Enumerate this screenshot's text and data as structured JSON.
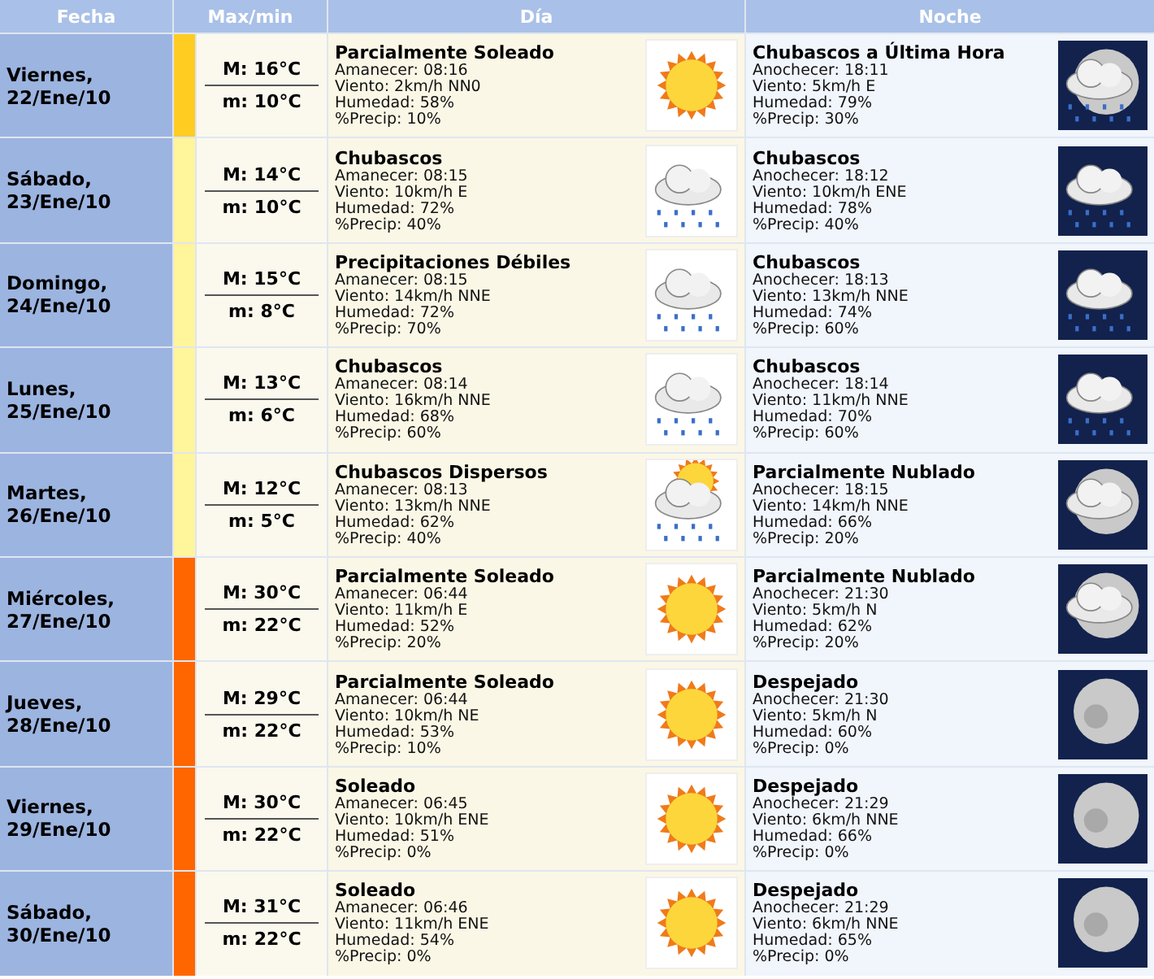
{
  "headers": [
    "Fecha",
    "Max/min",
    "Día",
    "Noche"
  ],
  "rows": [
    {
      "date": "Viernes,",
      "date2": "22/Ene/10",
      "color": "#ffcc22",
      "max": "M: 16°C",
      "min": "m: 10°C",
      "day": {
        "title": "Parcialmente Soleado",
        "lines": [
          "Amanecer: 08:16",
          "Viento: 2km/h NN0",
          "Humedad: 58%",
          "%Precip: 10%"
        ],
        "kind": "sun"
      },
      "night": {
        "title": "Chubascos a Última Hora",
        "lines": [
          "Anochecer: 18:11",
          "Viento: 5km/h E",
          "Humedad: 79%",
          "%Precip: 30%"
        ],
        "kind": "rainmoon"
      }
    },
    {
      "date": "Sábado,",
      "date2": "23/Ene/10",
      "color": "#fff59a",
      "max": "M: 14°C",
      "min": "m: 10°C",
      "day": {
        "title": "Chubascos",
        "lines": [
          "Amanecer: 08:15",
          "Viento: 10km/h E",
          "Humedad: 72%",
          "%Precip: 40%"
        ],
        "kind": "rain"
      },
      "night": {
        "title": "Chubascos",
        "lines": [
          "Anochecer: 18:12",
          "Viento: 10km/h ENE",
          "Humedad: 78%",
          "%Precip: 40%"
        ],
        "kind": "rain"
      }
    },
    {
      "date": "Domingo,",
      "date2": "24/Ene/10",
      "color": "#fff59a",
      "max": "M: 15°C",
      "min": "m: 8°C",
      "day": {
        "title": "Precipitaciones Débiles",
        "lines": [
          "Amanecer: 08:15",
          "Viento: 14km/h NNE",
          "Humedad: 72%",
          "%Precip: 70%"
        ],
        "kind": "rain"
      },
      "night": {
        "title": "Chubascos",
        "lines": [
          "Anochecer: 18:13",
          "Viento: 13km/h NNE",
          "Humedad: 74%",
          "%Precip: 60%"
        ],
        "kind": "rain"
      }
    },
    {
      "date": "Lunes,",
      "date2": "25/Ene/10",
      "color": "#fff59a",
      "max": "M: 13°C",
      "min": "m: 6°C",
      "day": {
        "title": "Chubascos",
        "lines": [
          "Amanecer: 08:14",
          "Viento: 16km/h NNE",
          "Humedad: 68%",
          "%Precip: 60%"
        ],
        "kind": "rain"
      },
      "night": {
        "title": "Chubascos",
        "lines": [
          "Anochecer: 18:14",
          "Viento: 11km/h NNE",
          "Humedad: 70%",
          "%Precip: 60%"
        ],
        "kind": "rain"
      }
    },
    {
      "date": "Martes,",
      "date2": "26/Ene/10",
      "color": "#fff59a",
      "max": "M: 12°C",
      "min": "m: 5°C",
      "day": {
        "title": "Chubascos Dispersos",
        "lines": [
          "Amanecer: 08:13",
          "Viento: 13km/h NNE",
          "Humedad: 62%",
          "%Precip: 40%"
        ],
        "kind": "sunrain"
      },
      "night": {
        "title": "Parcialmente Nublado",
        "lines": [
          "Anochecer: 18:15",
          "Viento: 14km/h NNE",
          "Humedad: 66%",
          "%Precip: 20%"
        ],
        "kind": "cloudmoon"
      }
    },
    {
      "date": "Miércoles,",
      "date2": "27/Ene/10",
      "color": "#ff6600",
      "max": "M: 30°C",
      "min": "m: 22°C",
      "day": {
        "title": "Parcialmente Soleado",
        "lines": [
          "Amanecer: 06:44",
          "Viento: 11km/h E",
          "Humedad: 52%",
          "%Precip: 20%"
        ],
        "kind": "sun"
      },
      "night": {
        "title": "Parcialmente Nublado",
        "lines": [
          "Anochecer: 21:30",
          "Viento: 5km/h N",
          "Humedad: 62%",
          "%Precip: 20%"
        ],
        "kind": "cloudmoon"
      }
    },
    {
      "date": "Jueves,",
      "date2": "28/Ene/10",
      "color": "#ff6600",
      "max": "M: 29°C",
      "min": "m: 22°C",
      "day": {
        "title": "Parcialmente Soleado",
        "lines": [
          "Amanecer: 06:44",
          "Viento: 10km/h NE",
          "Humedad: 53%",
          "%Precip: 10%"
        ],
        "kind": "sun"
      },
      "night": {
        "title": "Despejado",
        "lines": [
          "Anochecer: 21:30",
          "Viento: 5km/h N",
          "Humedad: 60%",
          "%Precip: 0%"
        ],
        "kind": "moon"
      }
    },
    {
      "date": "Viernes,",
      "date2": "29/Ene/10",
      "color": "#ff6600",
      "max": "M: 30°C",
      "min": "m: 22°C",
      "day": {
        "title": "Soleado",
        "lines": [
          "Amanecer: 06:45",
          "Viento: 10km/h ENE",
          "Humedad: 51%",
          "%Precip: 0%"
        ],
        "kind": "sun"
      },
      "night": {
        "title": "Despejado",
        "lines": [
          "Anochecer: 21:29",
          "Viento: 6km/h NNE",
          "Humedad: 66%",
          "%Precip: 0%"
        ],
        "kind": "moon"
      }
    },
    {
      "date": "Sábado,",
      "date2": "30/Ene/10",
      "color": "#ff6600",
      "max": "M: 31°C",
      "min": "m: 22°C",
      "day": {
        "title": "Soleado",
        "lines": [
          "Amanecer: 06:46",
          "Viento: 11km/h ENE",
          "Humedad: 54%",
          "%Precip: 0%"
        ],
        "kind": "sun"
      },
      "night": {
        "title": "Despejado",
        "lines": [
          "Anochecer: 21:29",
          "Viento: 6km/h NNE",
          "Humedad: 65%",
          "%Precip: 0%"
        ],
        "kind": "moon"
      }
    }
  ]
}
